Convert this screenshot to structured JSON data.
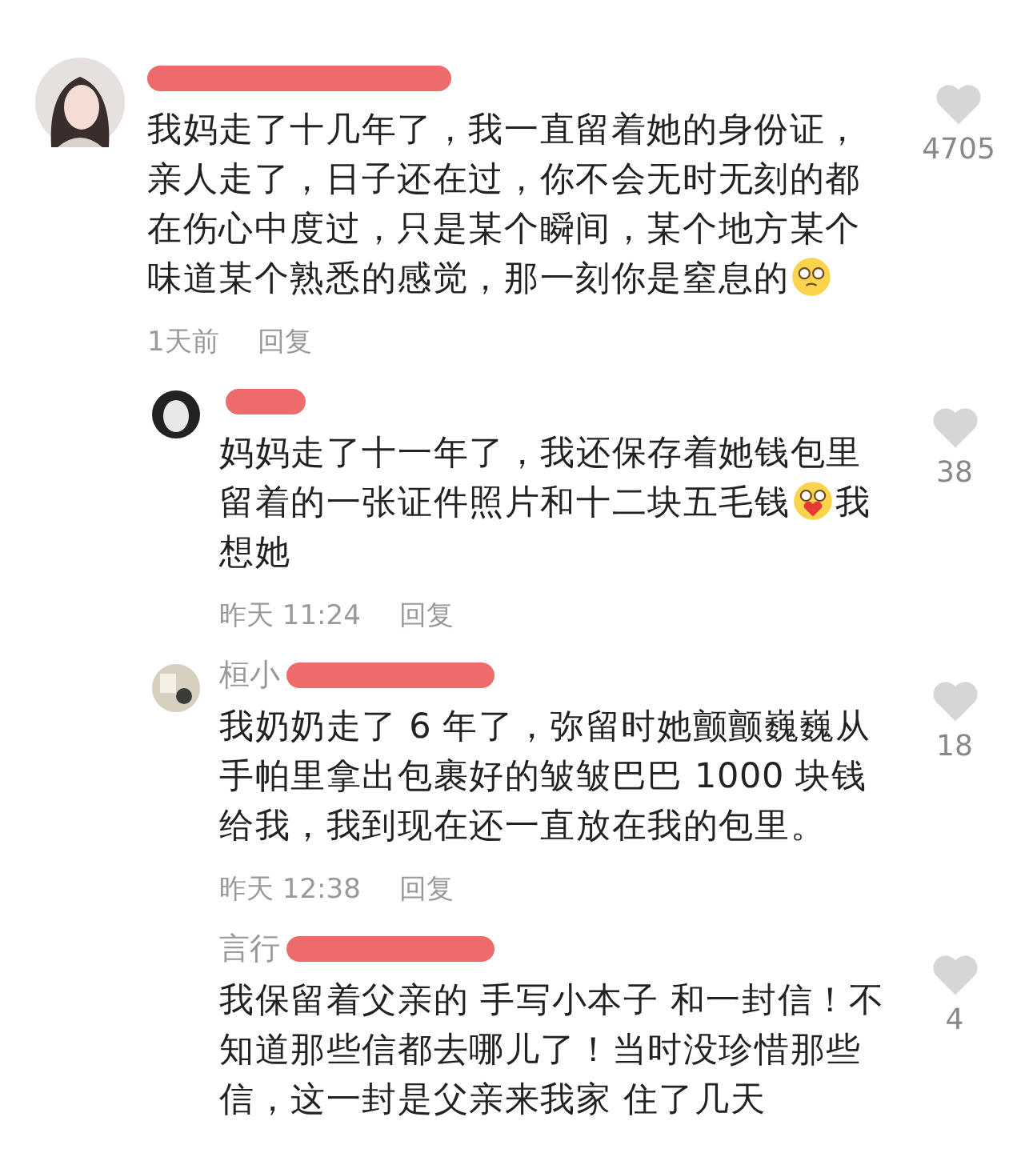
{
  "comments": [
    {
      "avatar": {
        "kind": "woman"
      },
      "likes": "4705",
      "segments": [
        {
          "kind": "text",
          "text": "我妈走了十几年了，我一直留着她的身份证，亲人走了，日子还在过，你不会无时无刻的都在伤心中度过，只是某个瞬间，某个地方某个味道某个熟悉的感觉，那一刻你是窒息的"
        },
        {
          "kind": "pleading"
        }
      ],
      "time": "1天前",
      "reply": "回复",
      "children": [
        {
          "avatar": {
            "kind": "face"
          },
          "likes": "38",
          "segments": [
            {
              "kind": "text",
              "text": "妈妈走了十一年了，我还保存着她钱包里留着的一张证件照片和十二块五毛钱"
            },
            {
              "kind": "heart"
            },
            {
              "kind": "text",
              "text": "我想她"
            }
          ],
          "time": "昨天 11:24",
          "reply": "回复"
        },
        {
          "avatar": {
            "kind": "room"
          },
          "name": "桓小",
          "likes": "18",
          "segments": [
            {
              "kind": "text",
              "text": "我奶奶走了 6 年了，弥留时她颤颤巍巍从手帕里拿出包裹好的皱皱巴巴 1000 块钱给我，我到现在还一直放在我的包里。"
            }
          ],
          "time": "昨天 12:38",
          "reply": "回复"
        },
        {
          "name": "言行",
          "likes": "4",
          "segments": [
            {
              "kind": "text",
              "text": "我保留着父亲的 手写小本子 和一封信！不知道那些信都去哪儿了！当时没珍惜那些信，这一封是父亲来我家 住了几天"
            }
          ]
        }
      ]
    }
  ]
}
